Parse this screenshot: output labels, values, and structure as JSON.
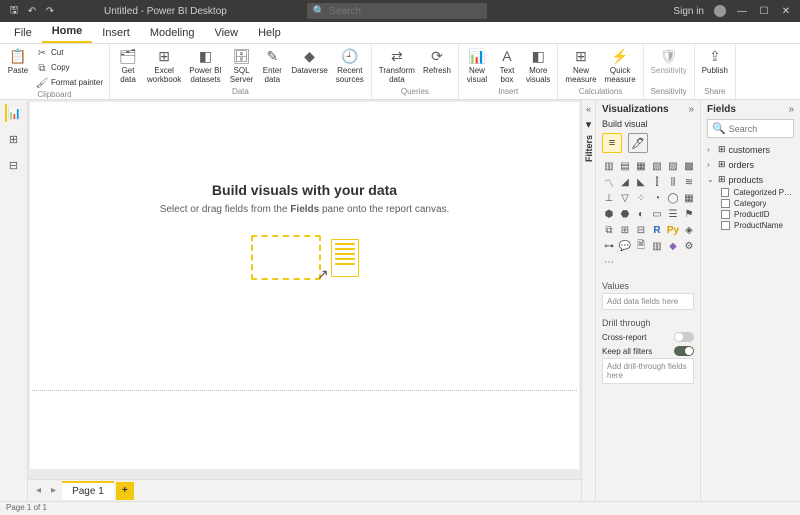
{
  "titlebar": {
    "title": "Untitled - Power BI Desktop",
    "search_placeholder": "Search",
    "signin": "Sign in"
  },
  "tabs": [
    "File",
    "Home",
    "Insert",
    "Modeling",
    "View",
    "Help"
  ],
  "active_tab": "Home",
  "ribbon": {
    "clipboard": {
      "label": "Clipboard",
      "paste": "Paste",
      "cut": "Cut",
      "copy": "Copy",
      "format": "Format painter"
    },
    "data": {
      "label": "Data",
      "get": "Get\ndata",
      "excel": "Excel\nworkbook",
      "pbi": "Power BI\ndatasets",
      "sql": "SQL\nServer",
      "enter": "Enter\ndata",
      "dataverse": "Dataverse",
      "recent": "Recent\nsources"
    },
    "queries": {
      "label": "Queries",
      "transform": "Transform\ndata",
      "refresh": "Refresh"
    },
    "insert": {
      "label": "Insert",
      "newvis": "New\nvisual",
      "textbox": "Text\nbox",
      "more": "More\nvisuals"
    },
    "calc": {
      "label": "Calculations",
      "measure": "New\nmeasure",
      "quick": "Quick\nmeasure"
    },
    "sens": {
      "label": "Sensitivity",
      "btn": "Sensitivity"
    },
    "share": {
      "label": "Share",
      "publish": "Publish"
    }
  },
  "report_tag": "Report",
  "canvas": {
    "heading": "Build visuals with your data",
    "sub_a": "Select or drag fields from the ",
    "sub_b": "Fields",
    "sub_c": " pane onto the report canvas."
  },
  "page_tabs": {
    "page1": "Page 1"
  },
  "filters_label": "Filters",
  "viz": {
    "title": "Visualizations",
    "build": "Build visual",
    "values": "Values",
    "values_ph": "Add data fields here",
    "drill": "Drill through",
    "cross": "Cross-report",
    "keep": "Keep all filters",
    "drill_ph": "Add drill-through fields here"
  },
  "fields": {
    "title": "Fields",
    "search_ph": "Search",
    "tables": [
      {
        "name": "customers",
        "expanded": false
      },
      {
        "name": "orders",
        "expanded": false
      },
      {
        "name": "products",
        "expanded": true,
        "cols": [
          "Categorized Pro…",
          "Category",
          "ProductID",
          "ProductName"
        ]
      }
    ]
  },
  "status": "Page 1 of 1"
}
